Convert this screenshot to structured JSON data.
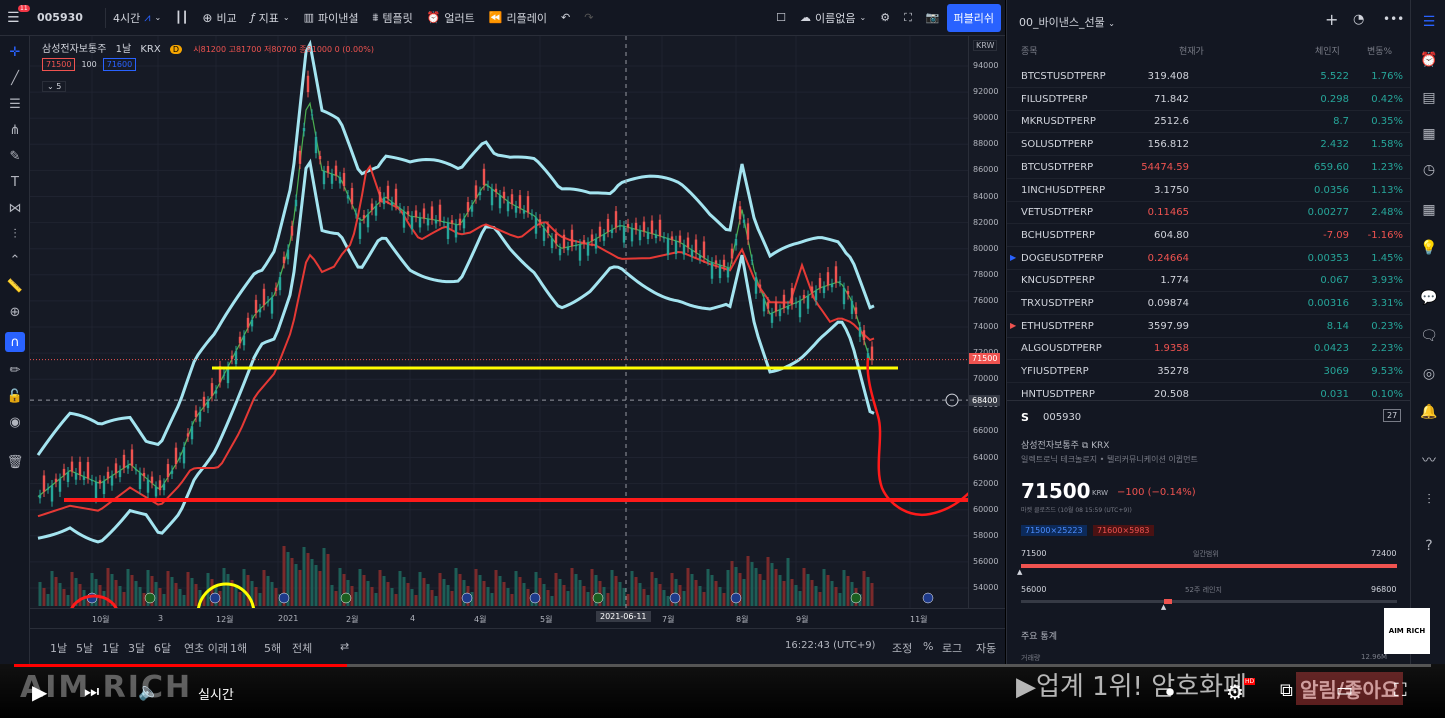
{
  "toolbar": {
    "symbol": "005930",
    "interval": "4시간",
    "compare": "비교",
    "indicators": "지표",
    "financials": "파이낸셜",
    "templates": "템플릿",
    "alert": "얼러트",
    "replay": "리플레이",
    "layout_name": "이름없음",
    "publish": "퍼블리쉬",
    "badge": "11"
  },
  "legend": {
    "title": "삼성전자보통주",
    "interval": "1날",
    "exchange": "KRX",
    "ohlc": "시81200 고81700 저80700 종81000 0 (0.00%)",
    "bid": "71500",
    "qty": "100",
    "ask": "71600",
    "collapse": "5"
  },
  "yaxis": {
    "currency": "KRW",
    "ticks": [
      "94000",
      "92000",
      "90000",
      "88000",
      "86000",
      "84000",
      "82000",
      "80000",
      "78000",
      "76000",
      "74000",
      "72000",
      "70000",
      "68000",
      "66000",
      "64000",
      "62000",
      "60000",
      "58000",
      "56000",
      "54000"
    ],
    "price_tag": "71500",
    "crosshair_tag": "68400"
  },
  "xaxis": {
    "labels": [
      "10월",
      "3",
      "12월",
      "2021",
      "2월",
      "4",
      "4월",
      "5월",
      "7월",
      "8월",
      "9월",
      "11월"
    ],
    "cursor_label": "2021-06-11"
  },
  "bottombar": {
    "ranges": [
      "1날",
      "5날",
      "1달",
      "3달",
      "6달",
      "연초 이래",
      "1해",
      "5해",
      "전체"
    ],
    "clock": "16:22:43 (UTC+9)",
    "adjust": "조정",
    "percent": "%",
    "log": "로그",
    "auto": "자동"
  },
  "watchlist": {
    "name": "00_바이낸스_선물",
    "col_symbol": "종목",
    "col_price": "현재가",
    "col_change": "체인지",
    "col_pct": "변동%",
    "rows": [
      {
        "sym": "BTCSTUSDTPERP",
        "price": "319.408",
        "chg": "5.522",
        "pct": "1.76%",
        "up": true
      },
      {
        "sym": "FILUSDTPERP",
        "price": "71.842",
        "chg": "0.298",
        "pct": "0.42%",
        "up": true
      },
      {
        "sym": "MKRUSDTPERP",
        "price": "2512.6",
        "chg": "8.7",
        "pct": "0.35%",
        "up": true
      },
      {
        "sym": "SOLUSDTPERP",
        "price": "156.812",
        "chg": "2.432",
        "pct": "1.58%",
        "up": true
      },
      {
        "sym": "BTCUSDTPERP",
        "price": "54474.59",
        "chg": "659.60",
        "pct": "1.23%",
        "up": true
      },
      {
        "sym": "1INCHUSDTPERP",
        "price": "3.1750",
        "chg": "0.0356",
        "pct": "1.13%",
        "up": true
      },
      {
        "sym": "VETUSDTPERP",
        "price": "0.11465",
        "chg": "0.00277",
        "pct": "2.48%",
        "up": true
      },
      {
        "sym": "BCHUSDTPERP",
        "price": "604.80",
        "chg": "-7.09",
        "pct": "-1.16%",
        "up": false
      },
      {
        "sym": "DOGEUSDTPERP",
        "price": "0.24664",
        "chg": "0.00353",
        "pct": "1.45%",
        "up": true
      },
      {
        "sym": "KNCUSDTPERP",
        "price": "1.774",
        "chg": "0.067",
        "pct": "3.93%",
        "up": true
      },
      {
        "sym": "TRXUSDTPERP",
        "price": "0.09874",
        "chg": "0.00316",
        "pct": "3.31%",
        "up": true
      },
      {
        "sym": "ETHUSDTPERP",
        "price": "3597.99",
        "chg": "8.14",
        "pct": "0.23%",
        "up": true
      },
      {
        "sym": "ALGOUSDTPERP",
        "price": "1.9358",
        "chg": "0.0423",
        "pct": "2.23%",
        "up": true
      },
      {
        "sym": "YFIUSDTPERP",
        "price": "35278",
        "chg": "3069",
        "pct": "9.53%",
        "up": true
      },
      {
        "sym": "HNTUSDTPERP",
        "price": "20.508",
        "chg": "0.031",
        "pct": "0.10%",
        "up": true
      }
    ]
  },
  "detail": {
    "symbol": "005930",
    "calendar": "27",
    "name": "삼성전자보통주",
    "exchange": "KRX",
    "sector": "일렉트로닉 테크놀로지 • 텔리커뮤니케이션 이큅먼트",
    "price": "71500",
    "price_unit": "KRW",
    "change": "−100 (−0.14%)",
    "status": "마켓 클로즈드 (10월 08 15:59 (UTC+9))",
    "bid_chip": "71500×25223",
    "ask_chip": "71600×5983",
    "day_low": "71500",
    "day_range_label": "일간범위",
    "day_high": "72400",
    "wk_low": "56000",
    "wk_label": "52주 레인지",
    "wk_high": "96800",
    "stats_label": "주요 통계",
    "stats_row": "거래량",
    "stats_val": "12.96M",
    "day_range_pct": 0.0,
    "wk_range_pct": 0.38
  },
  "overlay": {
    "brand": "AIM RICH",
    "corner_logo": "AIM RICH",
    "live": "실시간",
    "banner": "▶업계 1위! 암호화폐",
    "cta": "알림/좋아요",
    "progress_pct": 0.235,
    "hd": "HD"
  },
  "colors": {
    "accent": "#2962ff",
    "up": "#26a69a",
    "down": "#ef5350",
    "bollinger": "#a4e4f0",
    "ma_long": "#e53935",
    "annotation_yellow": "#ffff00",
    "annotation_red": "#ff1a1a"
  }
}
